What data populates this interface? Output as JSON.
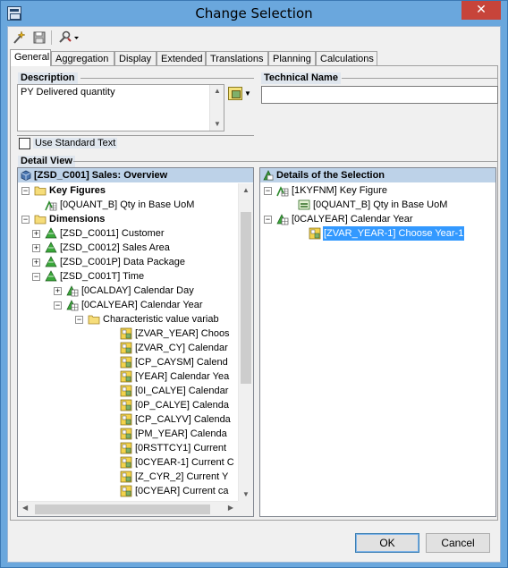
{
  "window": {
    "title": "Change Selection",
    "close_glyph": "✕"
  },
  "toolbar": {
    "icons": [
      "wand-icon",
      "save-icon",
      "tools-dropdown-icon"
    ]
  },
  "tabs": [
    {
      "label": "General",
      "active": true
    },
    {
      "label": "Aggregation"
    },
    {
      "label": "Display"
    },
    {
      "label": "Extended"
    },
    {
      "label": "Translations"
    },
    {
      "label": "Planning"
    },
    {
      "label": "Calculations"
    }
  ],
  "description": {
    "label": "Description",
    "value": "PY Delivered quantity",
    "use_standard_text": "Use Standard Text",
    "use_standard_checked": false
  },
  "technical_name": {
    "label": "Technical Name",
    "value": ""
  },
  "detail_view": {
    "label": "Detail View",
    "left_header": "[ZSD_C001] Sales: Overview",
    "right_header": "Details of the Selection",
    "left_tree": [
      {
        "text": "Key Figures",
        "bold": true
      },
      {
        "text": "[0QUANT_B] Qty in Base UoM"
      },
      {
        "text": "Dimensions",
        "bold": true
      },
      {
        "text": "[ZSD_C0011] Customer"
      },
      {
        "text": "[ZSD_C0012] Sales Area"
      },
      {
        "text": "[ZSD_C001P] Data Package"
      },
      {
        "text": "[ZSD_C001T] Time"
      },
      {
        "text": "[0CALDAY] Calendar Day"
      },
      {
        "text": "[0CALYEAR] Calendar Year"
      },
      {
        "text": "Characteristic value variab"
      },
      {
        "text": "[ZVAR_YEAR] Choos"
      },
      {
        "text": "[ZVAR_CY] Calendar"
      },
      {
        "text": "[CP_CAYSM] Calend"
      },
      {
        "text": "[YEAR] Calendar Yea"
      },
      {
        "text": "[0I_CALYE] Calendar"
      },
      {
        "text": "[0P_CALYE] Calenda"
      },
      {
        "text": "[CP_CALYV] Calenda"
      },
      {
        "text": "[PM_YEAR] Calenda"
      },
      {
        "text": "[0RSTTCY1] Current"
      },
      {
        "text": "[0CYEAR-1] Current C"
      },
      {
        "text": "[Z_CYR_2] Current Y"
      },
      {
        "text": "[0CYEAR] Current ca"
      }
    ],
    "right_tree": [
      {
        "text": "[1KYFNM] Key Figure"
      },
      {
        "text": "[0QUANT_B] Qty in Base UoM"
      },
      {
        "text": "[0CALYEAR] Calendar Year"
      },
      {
        "text": "[ZVAR_YEAR-1] Choose Year-1",
        "selected": true
      }
    ]
  },
  "buttons": {
    "ok": "OK",
    "cancel": "Cancel"
  },
  "colors": {
    "titlebar": "#6aa7dd",
    "close": "#c7443a",
    "selection": "#3399ff",
    "header": "#bdd2e8"
  }
}
